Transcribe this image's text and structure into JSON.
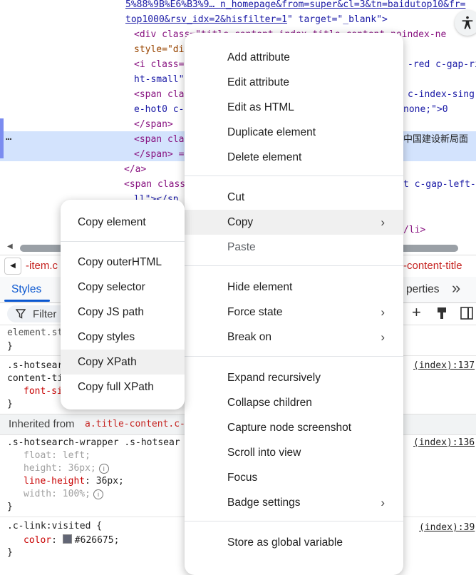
{
  "dom": {
    "line1": "5%88%9B%E6%B3%9… n_homepage&from=super&cl=3&tn=baidutop10&fr=",
    "line2_link": "top1000&rsv_idx=2&hisfilter=1",
    "line2_rest": "\" target=\"_blank\">",
    "line3": "<div class=\"title-content-index-title content-noindex-ne",
    "line4": "style=\"di",
    "line5": "<i class=",
    "line5b": "-red c-gap-ri",
    "line6": "ht-small\"",
    "line7": "<span cla",
    "line7b": "c-index-sing",
    "line8": "e-hot0 c-",
    "line8b": "none;\">0",
    "line9": "</span>",
    "line10": "<span cla",
    "line10b": "中国建设新局面",
    "line11": "</span> =",
    "line12": "</a>",
    "line13": "<span class",
    "line13b": "t c-gap-left-",
    "line14": "ll\"></sp",
    "line15b": "/li>",
    "ellipsis": "…"
  },
  "breadcrumb": {
    "left": "-item.c",
    "right": "-content-title"
  },
  "tabs": {
    "styles": "Styles",
    "properties": "perties",
    "more": "»"
  },
  "filter": {
    "placeholder": "Filter"
  },
  "rules": {
    "r1_selector": "element.st",
    "r1_close": "}",
    "r2_selector": ".s-hotsear",
    "r2_selector2": "content-ti",
    "r2_prop": "font-si",
    "r2_close": "}",
    "r2_source": "(index):137",
    "inherited_label": "Inherited from ",
    "inherited_from": "a.title-content.c-",
    "r3_selector": ".s-hotsearch-wrapper .s-hotsear",
    "r3_source": "(index):136",
    "r3_p1_name": "float",
    "r3_p1_val": "left;",
    "r3_p2_name": "height",
    "r3_p2_val": "36px;",
    "r3_p3_name": "line-height",
    "r3_p3_val": "36px;",
    "r3_p4_name": "width",
    "r3_p4_val": "100%;",
    "r3_close": "}",
    "r4_selector": ".c-link:visited {",
    "r4_source": "(index):39",
    "r4_p1_name": "color",
    "r4_p1_val": "#626675;",
    "r4_color": "#626675",
    "r4_close": "}"
  },
  "context_menu": {
    "items": [
      "Add attribute",
      "Edit attribute",
      "Edit as HTML",
      "Duplicate element",
      "Delete element",
      "Cut",
      "Copy",
      "Paste",
      "Hide element",
      "Force state",
      "Break on",
      "Expand recursively",
      "Collapse children",
      "Capture node screenshot",
      "Scroll into view",
      "Focus",
      "Badge settings",
      "Store as global variable"
    ]
  },
  "copy_submenu": {
    "items": [
      "Copy element",
      "Copy outerHTML",
      "Copy selector",
      "Copy JS path",
      "Copy styles",
      "Copy XPath",
      "Copy full XPath"
    ]
  },
  "colors": {
    "selection": "#d3e3fd",
    "accent": "#0b57d0",
    "tag": "#881280",
    "attr": "#994500"
  }
}
